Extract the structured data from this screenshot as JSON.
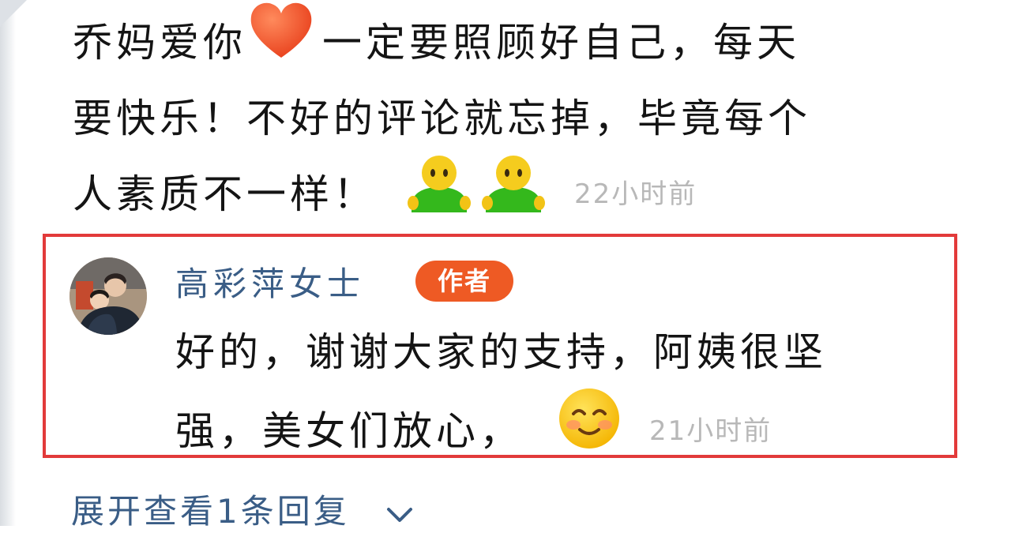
{
  "comment": {
    "line1_part1": "乔妈爱你",
    "line1_part2": "一定要照顾好自己，每天",
    "line2": "要快乐！不好的评论就忘掉，毕竟每个",
    "line3": "人素质不一样！",
    "time": "22小时前",
    "heart_icon": "heart-icon",
    "emoji_icons": [
      "green-person-emoji",
      "green-person-emoji"
    ]
  },
  "reply": {
    "username": "高彩萍女士",
    "badge": "作者",
    "line1": "好的，谢谢大家的支持，阿姨很坚",
    "line2": "强，美女们放心，",
    "emoji_icon": "smiling-face-emoji",
    "time": "21小时前"
  },
  "footer": {
    "expand_label": "展开查看1条回复",
    "chevron_icon": "chevron-down-icon"
  },
  "colors": {
    "highlight_border": "#e23a3a",
    "badge": "#ee5a24",
    "link": "#3a5d86",
    "time": "#b8b8b8"
  }
}
